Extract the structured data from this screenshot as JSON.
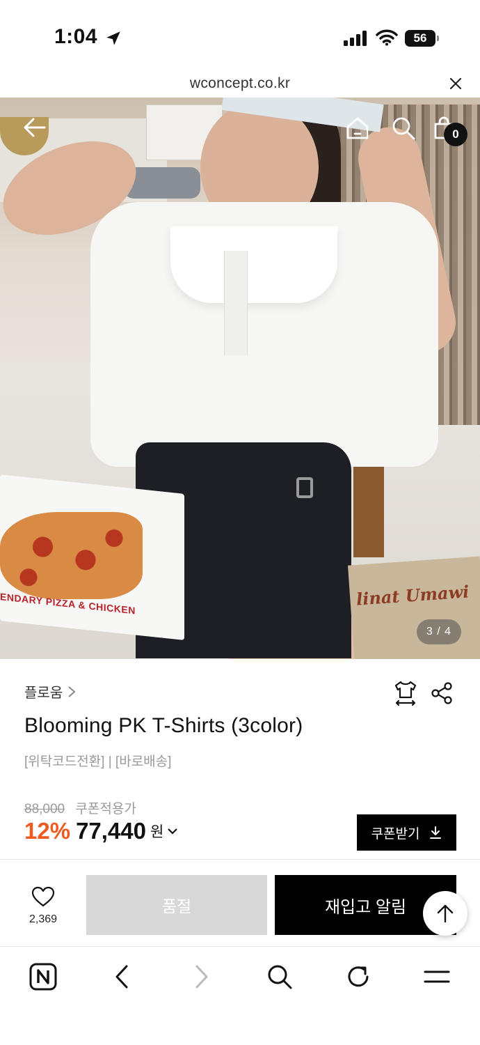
{
  "status_bar": {
    "time": "1:04",
    "battery": "56"
  },
  "browser": {
    "url": "wconcept.co.kr"
  },
  "hero": {
    "image_counter": "3 / 4",
    "pizza_box_text": "ENDARY PIZZA & CHICKEN",
    "paper_text": "linat Umawi",
    "cart_count": "0"
  },
  "product": {
    "brand": "플로움",
    "title": "Blooming PK T-Shirts (3color)",
    "tags": "[위탁코드전환] | [바로배송]",
    "original_price": "88,000",
    "coupon_price_label": "쿠폰적용가",
    "discount": "12%",
    "final_price": "77,440",
    "price_unit": "원",
    "coupon_button_label": "쿠폰받기"
  },
  "action_bar": {
    "like_count": "2,369",
    "soldout_label": "품절",
    "restock_label": "재입고 알림"
  },
  "colors": {
    "accent_discount": "#ef5a21",
    "black": "#000000",
    "soldout_gray": "#d8d8d8"
  },
  "icons": [
    "location-arrow-icon",
    "signal-icon",
    "wifi-icon",
    "close-icon",
    "back-arrow-icon",
    "home-icon",
    "search-icon",
    "cart-icon",
    "chevron-right-icon",
    "size-guide-icon",
    "share-icon",
    "chevron-down-icon",
    "download-icon",
    "heart-icon",
    "arrow-up-icon",
    "naver-icon",
    "browser-back-icon",
    "browser-forward-icon",
    "browser-search-icon",
    "refresh-icon",
    "menu-icon"
  ]
}
